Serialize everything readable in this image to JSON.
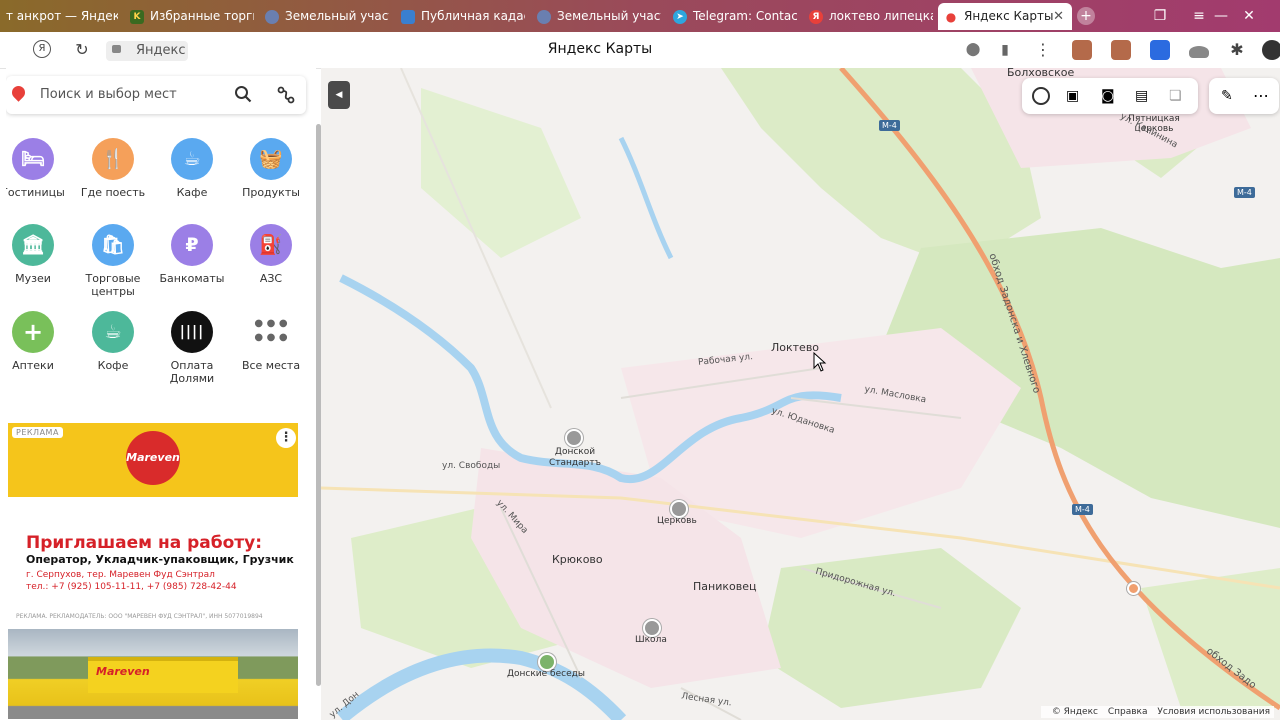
{
  "tabs": [
    {
      "label": "т анкрот — Яндекс",
      "icon": "yandex-icon",
      "color": "#c9a66b"
    },
    {
      "label": "Избранные торги",
      "icon": "torgi-icon",
      "color": "#4a7a2a"
    },
    {
      "label": "Земельный участ",
      "icon": "globe-icon",
      "color": "#6a7fb0"
    },
    {
      "label": "Публичная кадас",
      "icon": "rosreestr-icon",
      "color": "#3a7fcf"
    },
    {
      "label": "Земельный участ",
      "icon": "globe-icon",
      "color": "#6a7fb0"
    },
    {
      "label": "Telegram: Contact",
      "icon": "telegram-icon",
      "color": "#2ea6de"
    },
    {
      "label": "локтево липецка",
      "icon": "yandex-icon",
      "color": "#e8403a"
    },
    {
      "label": "Яндекс Карты",
      "icon": "maps-pin-icon",
      "color": "#e8403a",
      "active": true
    }
  ],
  "address_bar": {
    "url_chip": "Яндекс",
    "page_title": "Яндекс Карты"
  },
  "search": {
    "placeholder": "Поиск и выбор мест"
  },
  "categories": [
    {
      "label": "Гостиницы",
      "icon": "bed-icon",
      "glyph": "🛏",
      "color": "#9b7fe6"
    },
    {
      "label": "Где поесть",
      "icon": "fork-knife-icon",
      "glyph": "🍴",
      "color": "#f5a05a"
    },
    {
      "label": "Кафе",
      "icon": "cup-icon",
      "glyph": "☕",
      "color": "#5aa9f0"
    },
    {
      "label": "Продукты",
      "icon": "basket-icon",
      "glyph": "🧺",
      "color": "#5aa9f0"
    },
    {
      "label": "Музеи",
      "icon": "museum-icon",
      "glyph": "🏛",
      "color": "#4db89a"
    },
    {
      "label": "Торговые центры",
      "icon": "shopping-bag-icon",
      "glyph": "🛍",
      "color": "#5aa9f0"
    },
    {
      "label": "Банкоматы",
      "icon": "ruble-icon",
      "glyph": "₽",
      "color": "#9b7fe6"
    },
    {
      "label": "АЗС",
      "icon": "fuel-icon",
      "glyph": "⛽",
      "color": "#9b7fe6"
    },
    {
      "label": "Аптеки",
      "icon": "plus-icon",
      "glyph": "+",
      "color": "#79c05a"
    },
    {
      "label": "Кофе",
      "icon": "coffee-icon",
      "glyph": "☕",
      "color": "#4db89a"
    },
    {
      "label": "Оплата Долями",
      "icon": "dolyami-icon",
      "glyph": "||||",
      "color": "#111111"
    },
    {
      "label": "Все места",
      "icon": "grid-dots-icon",
      "glyph": "⋯",
      "color": "#ffffff"
    }
  ],
  "ad": {
    "badge": "РЕКЛАМА",
    "logo_text": "Mareven",
    "headline": "Приглашаем на работу:",
    "positions": "Оператор, Укладчик-упаковщик, Грузчик",
    "address": "г. Серпухов, тер. Маревен Фуд Сэнтрал",
    "phone": "тел.: +7 (925) 105-11-11, +7 (985) 728-42-44",
    "legal": "РЕКЛАМА. РЕКЛАМОДАТЕЛЬ: ООО \"МАРЕВЕН ФУД СЭНТРАЛ\", ИНН 5077019894"
  },
  "map": {
    "places": [
      {
        "name": "Болховское"
      },
      {
        "name": "Пятницкая церковь"
      },
      {
        "name": "Локтево"
      },
      {
        "name": "Донской Стандартъ"
      },
      {
        "name": "Церковь"
      },
      {
        "name": "Крюково"
      },
      {
        "name": "Паниковец"
      },
      {
        "name": "Школа"
      },
      {
        "name": "Донские беседы"
      }
    ],
    "streets": [
      {
        "name": "ул. Калинина"
      },
      {
        "name": "Рабочая ул."
      },
      {
        "name": "ул. Масловка"
      },
      {
        "name": "ул. Юдановка"
      },
      {
        "name": "ул. Свободы"
      },
      {
        "name": "ул. Мира"
      },
      {
        "name": "Придорожная ул."
      },
      {
        "name": "Лесная ул."
      },
      {
        "name": "обход Задонска и Хлевного"
      },
      {
        "name": "обход Задо"
      },
      {
        "name": "ул. Дон"
      }
    ],
    "road_shields": [
      "М-4",
      "М-4",
      "М-4"
    ],
    "footer": {
      "copyright": "© Яндекс",
      "help": "Справка",
      "terms": "Условия использования"
    }
  }
}
